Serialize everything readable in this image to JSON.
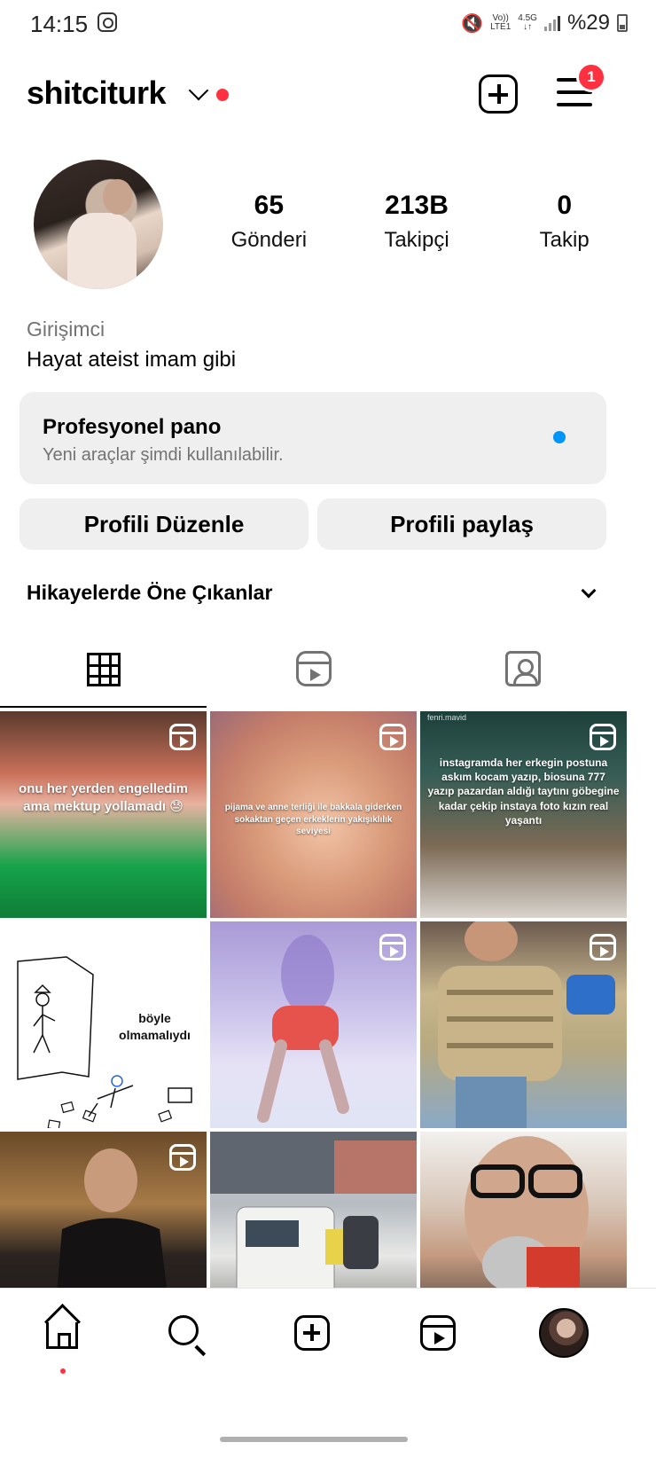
{
  "status_bar": {
    "time": "14:15",
    "network_top": "Vo))",
    "network_bottom": "LTE1",
    "data_type": "4.5G",
    "battery": "%29"
  },
  "header": {
    "username": "shitciturk",
    "notification_count": "1"
  },
  "profile": {
    "stats": [
      {
        "value": "65",
        "label": "Gönderi"
      },
      {
        "value": "213B",
        "label": "Takipçi"
      },
      {
        "value": "0",
        "label": "Takip"
      }
    ],
    "category": "Girişimci",
    "bio": "Hayat ateist imam gibi"
  },
  "pro_dashboard": {
    "title": "Profesyonel pano",
    "subtitle": "Yeni araçlar şimdi kullanılabilir."
  },
  "buttons": {
    "edit_profile": "Profili Düzenle",
    "share_profile": "Profili paylaş"
  },
  "highlights": {
    "title": "Hikayelerde Öne Çıkanlar"
  },
  "posts": [
    {
      "caption": "onu her yerden engelledim ama mektup yollamadı 😓",
      "is_reel": true
    },
    {
      "caption": "pijama ve anne terliği ile bakkala giderken sokaktan geçen erkeklerin yakışıklılık seviyesi",
      "is_reel": true
    },
    {
      "caption": "instagramda her erkegin postuna askım kocam yazıp, biosuna 777 yazıp pazardan aldığı taytını göbegine kadar çekip instaya foto kızın real yaşantı",
      "is_reel": true,
      "watermark": "fenri.mavid"
    },
    {
      "caption": "böyle olmamalıydı",
      "is_reel": false
    },
    {
      "caption": "",
      "is_reel": true
    },
    {
      "caption": "",
      "is_reel": true
    },
    {
      "caption": "",
      "is_reel": true
    },
    {
      "caption": "",
      "is_reel": false
    },
    {
      "caption": "",
      "is_reel": false
    }
  ],
  "colors": {
    "accent_red": "#ff3040",
    "accent_blue": "#0095f6",
    "button_bg": "#efefef",
    "muted_text": "#737373"
  }
}
